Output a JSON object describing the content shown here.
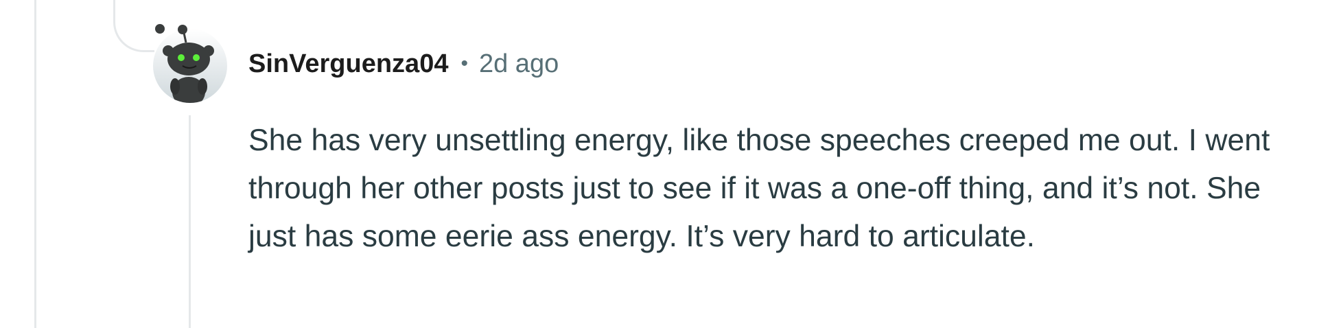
{
  "comment": {
    "author": "SinVerguenza04",
    "separator": "•",
    "timestamp": "2d ago",
    "body": "She has very unsettling energy, like those speeches creeped me out. I went through her other posts just to see if it was a one-off thing, and it’s not. She just has some eerie ass energy. It’s very hard to articulate."
  },
  "avatar": {
    "icon": "snoo-avatar-icon",
    "body_color": "#3a3d3d",
    "eye_color": "#5cef3a",
    "background_color": "#dfe5e8"
  },
  "colors": {
    "thread_line": "#e5e8ea",
    "username": "#1c1c1c",
    "meta": "#576f76",
    "body_text": "#2a3c42"
  }
}
